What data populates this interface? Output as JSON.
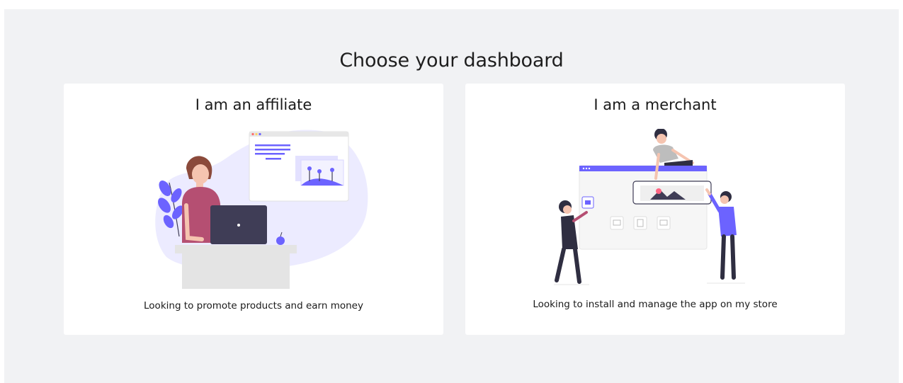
{
  "page": {
    "title": "Choose your dashboard"
  },
  "cards": [
    {
      "title": "I am an affiliate",
      "description": "Looking to promote products and earn money",
      "illustration": "affiliate-illustration"
    },
    {
      "title": "I am a merchant",
      "description": "Looking to install and manage the app on my store",
      "illustration": "merchant-illustration"
    }
  ],
  "colors": {
    "background": "#f1f2f4",
    "card": "#ffffff",
    "accent": "#6c63ff",
    "text": "#1a1a1a"
  }
}
